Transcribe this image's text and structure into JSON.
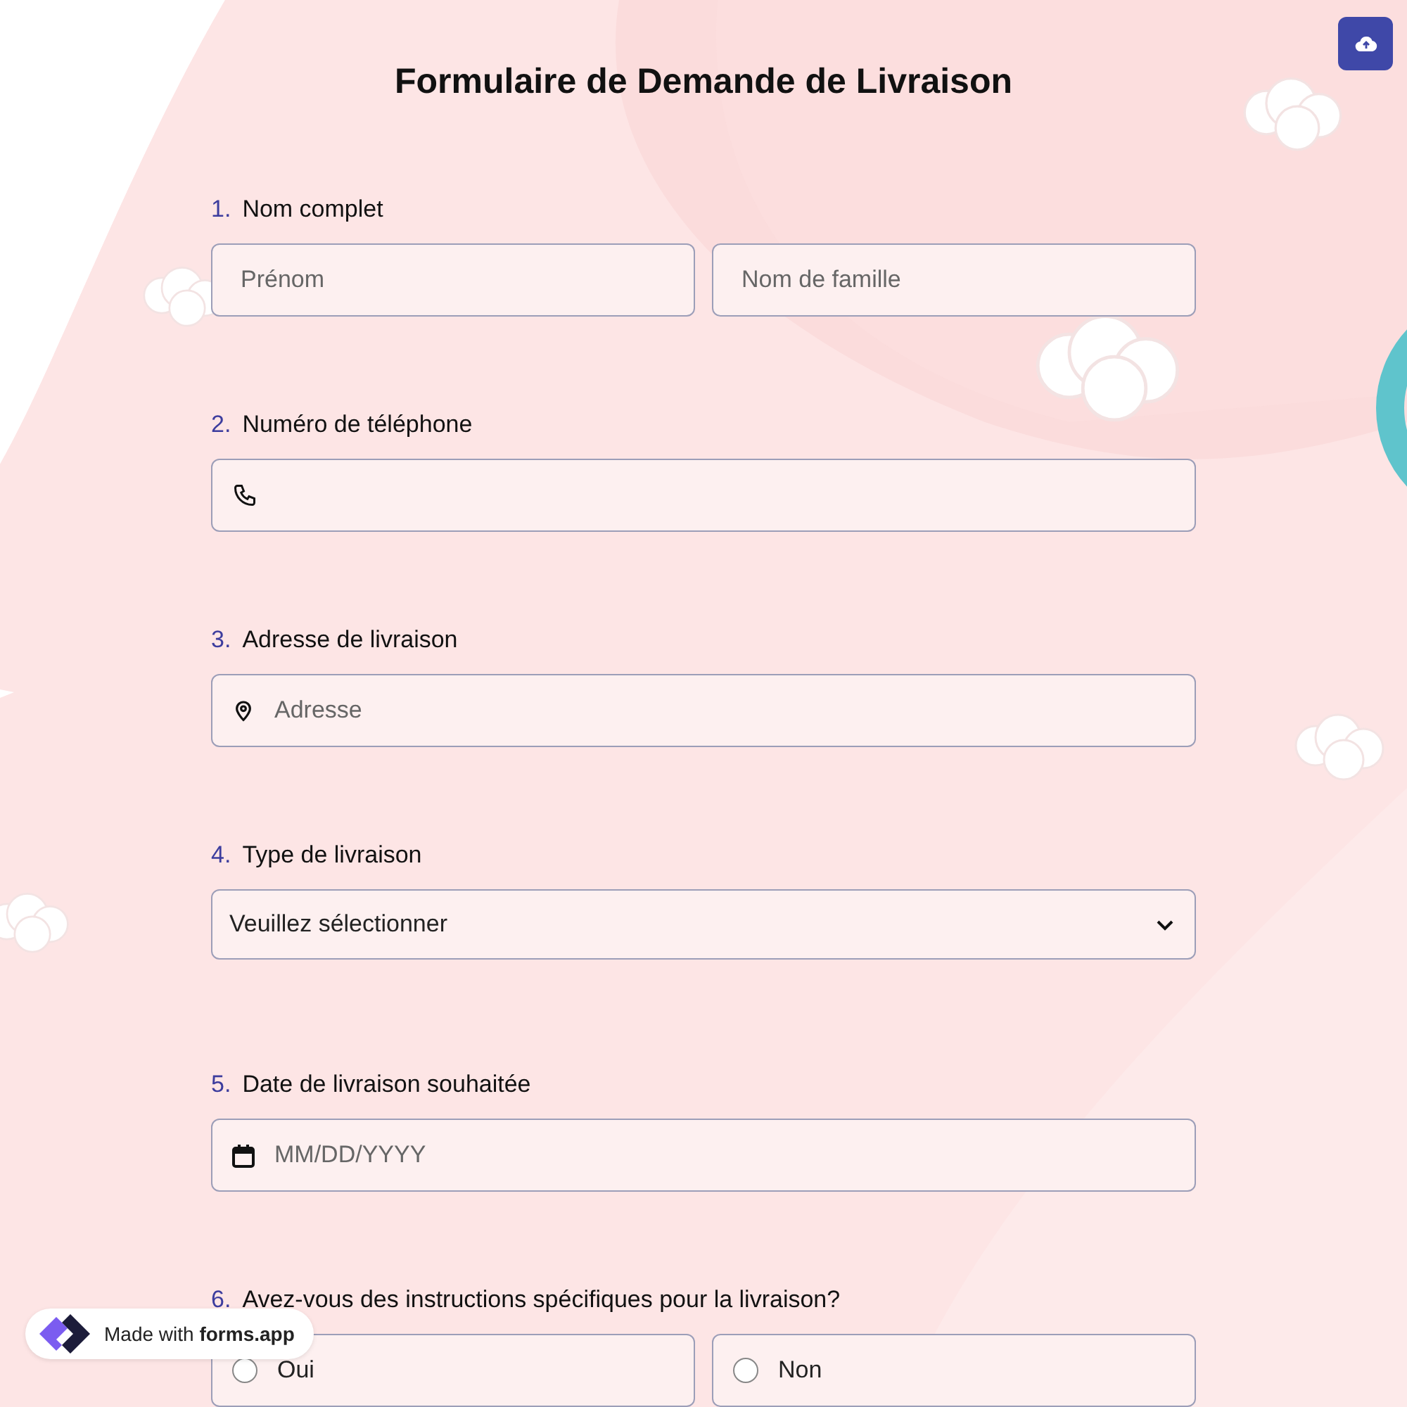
{
  "title": "Formulaire de Demande de Livraison",
  "questions": [
    {
      "number": "1.",
      "label": "Nom complet",
      "kind": "name_pair",
      "fields": [
        {
          "placeholder": "Prénom"
        },
        {
          "placeholder": "Nom de famille"
        }
      ]
    },
    {
      "number": "2.",
      "label": "Numéro de téléphone",
      "kind": "phone"
    },
    {
      "number": "3.",
      "label": "Adresse de livraison",
      "kind": "address",
      "placeholder": "Adresse"
    },
    {
      "number": "4.",
      "label": "Type de livraison",
      "kind": "select",
      "value": "Veuillez sélectionner"
    },
    {
      "number": "5.",
      "label": "Date de livraison souhaitée",
      "kind": "date",
      "placeholder": "MM/DD/YYYY"
    },
    {
      "number": "6.",
      "label": "Avez-vous des instructions spécifiques pour la livraison?",
      "kind": "radio",
      "options": [
        {
          "label": "Oui",
          "selected": false
        },
        {
          "label": "Non",
          "selected": false
        }
      ]
    }
  ],
  "badge": {
    "text": "Made with **forms.app**"
  }
}
